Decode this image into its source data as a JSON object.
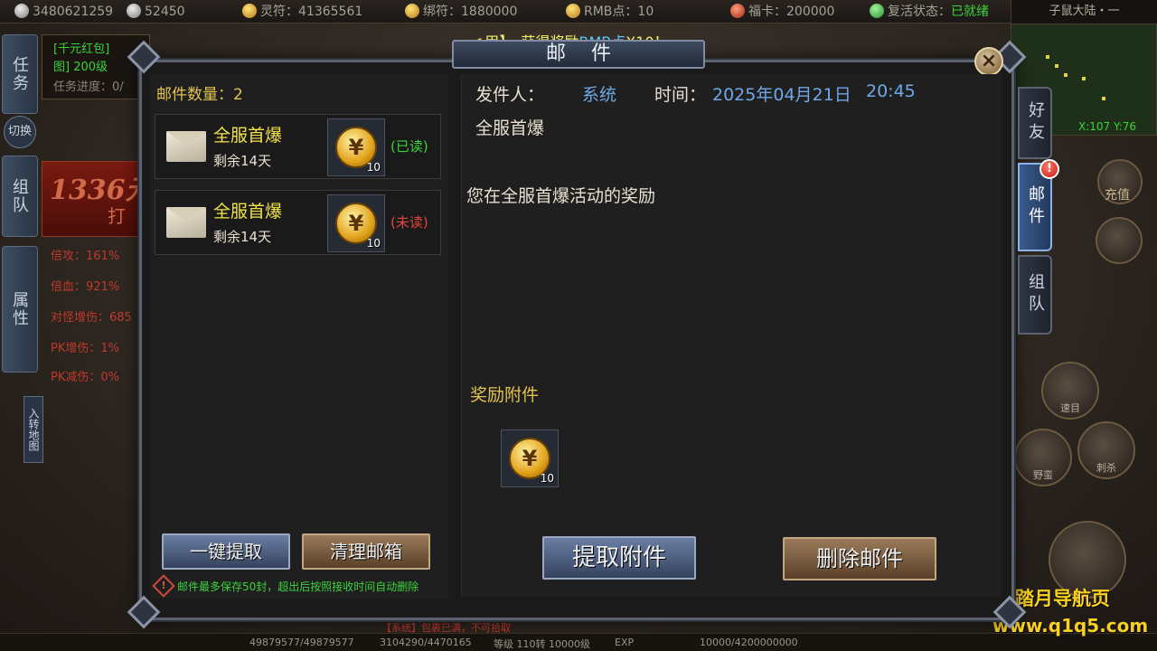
{
  "topbar": {
    "ingots": "3480621259",
    "silver": "52450",
    "lingfu": "灵符：41365561",
    "bangfu": "绑符：1880000",
    "rmb": "RMB点：10",
    "fuka": "福卡：200000",
    "revive_label": "复活状态：",
    "revive_value": "已就绪",
    "region": "子鼠大陆・一"
  },
  "notice": {
    "prefix": "甲】，获得奖励",
    "highlight": "RMB点",
    "suffix": "X10！"
  },
  "left_hud": {
    "quest_tab": "任务",
    "quest_line1": "[千元红包]",
    "quest_line2": "图] 200级",
    "quest_line3": "任务进度：0/",
    "switch": "切换",
    "team_tab": "组队",
    "promo_amount": "1336元",
    "promo_tail": "打",
    "attr_tab": "属性",
    "attrs": [
      "倍攻：161%",
      "倍血：921%",
      "对怪增伤：685",
      "PK增伤：1%",
      "PK减伤：0%"
    ],
    "map_button": "入转地图"
  },
  "right_hud": {
    "coord": "X:107 Y:76",
    "recharge": "充值",
    "skill_labels": [
      "速目",
      "野蛮",
      "刺杀"
    ]
  },
  "bottombar": {
    "hp": "49879577/49879577",
    "mp": "3104290/4470165",
    "level": "等级 110转 10000级",
    "exp_label": "EXP",
    "exp": "10000/4200000000",
    "chat": "【系统】包裹已满，不可拾取"
  },
  "watermark": {
    "line1": "踏月导航页",
    "line2": "www.q1q5.com"
  },
  "mail": {
    "window_title": "邮件",
    "close_glyph": "×",
    "count_label": "邮件数量：2",
    "items": [
      {
        "title": "全服首爆",
        "days_left": "剩余14天",
        "qty": "10",
        "status": "(已读)",
        "status_color": "#3bd23b"
      },
      {
        "title": "全服首爆",
        "days_left": "剩余14天",
        "qty": "10",
        "status": "(未读)",
        "status_color": "#e0463a"
      }
    ],
    "coin_glyph": "¥",
    "claim_all_button": "一键提取",
    "clear_button": "清理邮箱",
    "note_glyph": "!",
    "note": "邮件最多保存50封，超出后按照接收时间自动删除",
    "detail": {
      "sender_label": "发件人：",
      "sender": "系统",
      "time_label": "时间：",
      "date": "2025年04月21日",
      "time": "20:45",
      "subject": "全服首爆",
      "body": "您在全服首爆活动的奖励",
      "attachment_label": "奖励附件",
      "attachment_qty": "10",
      "claim_button": "提取附件",
      "delete_button": "删除邮件"
    },
    "side_tabs": {
      "friends": "好友",
      "mail": "邮件",
      "team": "组队",
      "badge": "!"
    }
  }
}
